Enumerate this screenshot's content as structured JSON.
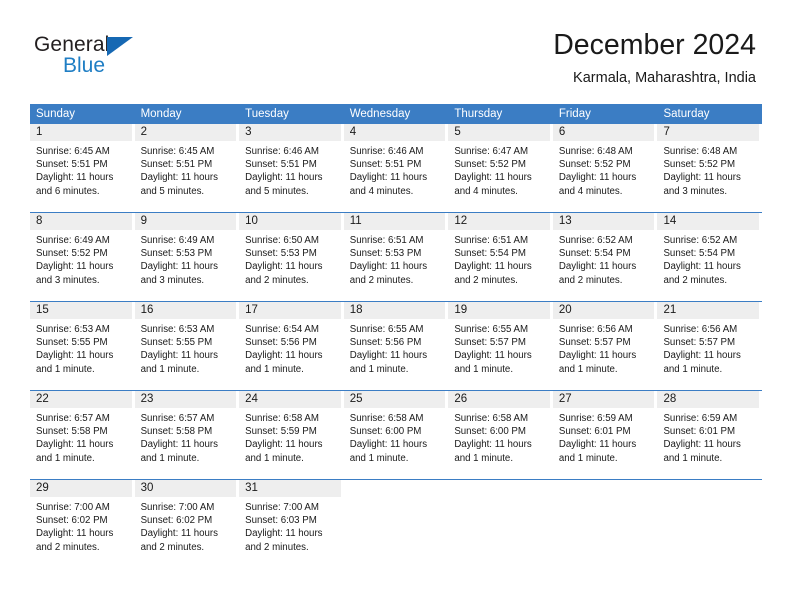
{
  "brand": {
    "name_part1": "General",
    "name_part2": "Blue",
    "accent_color": "#1f7ec4",
    "triangle_color": "#1668b3"
  },
  "header": {
    "title": "December 2024",
    "location": "Karmala, Maharashtra, India"
  },
  "calendar": {
    "header_color": "#3b7dc4",
    "daynum_band_color": "#eeeeee",
    "weekday_names": [
      "Sunday",
      "Monday",
      "Tuesday",
      "Wednesday",
      "Thursday",
      "Friday",
      "Saturday"
    ],
    "weeks": [
      [
        {
          "day": "1",
          "sunrise": "Sunrise: 6:45 AM",
          "sunset": "Sunset: 5:51 PM",
          "daylight_line1": "Daylight: 11 hours",
          "daylight_line2": "and 6 minutes."
        },
        {
          "day": "2",
          "sunrise": "Sunrise: 6:45 AM",
          "sunset": "Sunset: 5:51 PM",
          "daylight_line1": "Daylight: 11 hours",
          "daylight_line2": "and 5 minutes."
        },
        {
          "day": "3",
          "sunrise": "Sunrise: 6:46 AM",
          "sunset": "Sunset: 5:51 PM",
          "daylight_line1": "Daylight: 11 hours",
          "daylight_line2": "and 5 minutes."
        },
        {
          "day": "4",
          "sunrise": "Sunrise: 6:46 AM",
          "sunset": "Sunset: 5:51 PM",
          "daylight_line1": "Daylight: 11 hours",
          "daylight_line2": "and 4 minutes."
        },
        {
          "day": "5",
          "sunrise": "Sunrise: 6:47 AM",
          "sunset": "Sunset: 5:52 PM",
          "daylight_line1": "Daylight: 11 hours",
          "daylight_line2": "and 4 minutes."
        },
        {
          "day": "6",
          "sunrise": "Sunrise: 6:48 AM",
          "sunset": "Sunset: 5:52 PM",
          "daylight_line1": "Daylight: 11 hours",
          "daylight_line2": "and 4 minutes."
        },
        {
          "day": "7",
          "sunrise": "Sunrise: 6:48 AM",
          "sunset": "Sunset: 5:52 PM",
          "daylight_line1": "Daylight: 11 hours",
          "daylight_line2": "and 3 minutes."
        }
      ],
      [
        {
          "day": "8",
          "sunrise": "Sunrise: 6:49 AM",
          "sunset": "Sunset: 5:52 PM",
          "daylight_line1": "Daylight: 11 hours",
          "daylight_line2": "and 3 minutes."
        },
        {
          "day": "9",
          "sunrise": "Sunrise: 6:49 AM",
          "sunset": "Sunset: 5:53 PM",
          "daylight_line1": "Daylight: 11 hours",
          "daylight_line2": "and 3 minutes."
        },
        {
          "day": "10",
          "sunrise": "Sunrise: 6:50 AM",
          "sunset": "Sunset: 5:53 PM",
          "daylight_line1": "Daylight: 11 hours",
          "daylight_line2": "and 2 minutes."
        },
        {
          "day": "11",
          "sunrise": "Sunrise: 6:51 AM",
          "sunset": "Sunset: 5:53 PM",
          "daylight_line1": "Daylight: 11 hours",
          "daylight_line2": "and 2 minutes."
        },
        {
          "day": "12",
          "sunrise": "Sunrise: 6:51 AM",
          "sunset": "Sunset: 5:54 PM",
          "daylight_line1": "Daylight: 11 hours",
          "daylight_line2": "and 2 minutes."
        },
        {
          "day": "13",
          "sunrise": "Sunrise: 6:52 AM",
          "sunset": "Sunset: 5:54 PM",
          "daylight_line1": "Daylight: 11 hours",
          "daylight_line2": "and 2 minutes."
        },
        {
          "day": "14",
          "sunrise": "Sunrise: 6:52 AM",
          "sunset": "Sunset: 5:54 PM",
          "daylight_line1": "Daylight: 11 hours",
          "daylight_line2": "and 2 minutes."
        }
      ],
      [
        {
          "day": "15",
          "sunrise": "Sunrise: 6:53 AM",
          "sunset": "Sunset: 5:55 PM",
          "daylight_line1": "Daylight: 11 hours",
          "daylight_line2": "and 1 minute."
        },
        {
          "day": "16",
          "sunrise": "Sunrise: 6:53 AM",
          "sunset": "Sunset: 5:55 PM",
          "daylight_line1": "Daylight: 11 hours",
          "daylight_line2": "and 1 minute."
        },
        {
          "day": "17",
          "sunrise": "Sunrise: 6:54 AM",
          "sunset": "Sunset: 5:56 PM",
          "daylight_line1": "Daylight: 11 hours",
          "daylight_line2": "and 1 minute."
        },
        {
          "day": "18",
          "sunrise": "Sunrise: 6:55 AM",
          "sunset": "Sunset: 5:56 PM",
          "daylight_line1": "Daylight: 11 hours",
          "daylight_line2": "and 1 minute."
        },
        {
          "day": "19",
          "sunrise": "Sunrise: 6:55 AM",
          "sunset": "Sunset: 5:57 PM",
          "daylight_line1": "Daylight: 11 hours",
          "daylight_line2": "and 1 minute."
        },
        {
          "day": "20",
          "sunrise": "Sunrise: 6:56 AM",
          "sunset": "Sunset: 5:57 PM",
          "daylight_line1": "Daylight: 11 hours",
          "daylight_line2": "and 1 minute."
        },
        {
          "day": "21",
          "sunrise": "Sunrise: 6:56 AM",
          "sunset": "Sunset: 5:57 PM",
          "daylight_line1": "Daylight: 11 hours",
          "daylight_line2": "and 1 minute."
        }
      ],
      [
        {
          "day": "22",
          "sunrise": "Sunrise: 6:57 AM",
          "sunset": "Sunset: 5:58 PM",
          "daylight_line1": "Daylight: 11 hours",
          "daylight_line2": "and 1 minute."
        },
        {
          "day": "23",
          "sunrise": "Sunrise: 6:57 AM",
          "sunset": "Sunset: 5:58 PM",
          "daylight_line1": "Daylight: 11 hours",
          "daylight_line2": "and 1 minute."
        },
        {
          "day": "24",
          "sunrise": "Sunrise: 6:58 AM",
          "sunset": "Sunset: 5:59 PM",
          "daylight_line1": "Daylight: 11 hours",
          "daylight_line2": "and 1 minute."
        },
        {
          "day": "25",
          "sunrise": "Sunrise: 6:58 AM",
          "sunset": "Sunset: 6:00 PM",
          "daylight_line1": "Daylight: 11 hours",
          "daylight_line2": "and 1 minute."
        },
        {
          "day": "26",
          "sunrise": "Sunrise: 6:58 AM",
          "sunset": "Sunset: 6:00 PM",
          "daylight_line1": "Daylight: 11 hours",
          "daylight_line2": "and 1 minute."
        },
        {
          "day": "27",
          "sunrise": "Sunrise: 6:59 AM",
          "sunset": "Sunset: 6:01 PM",
          "daylight_line1": "Daylight: 11 hours",
          "daylight_line2": "and 1 minute."
        },
        {
          "day": "28",
          "sunrise": "Sunrise: 6:59 AM",
          "sunset": "Sunset: 6:01 PM",
          "daylight_line1": "Daylight: 11 hours",
          "daylight_line2": "and 1 minute."
        }
      ],
      [
        {
          "day": "29",
          "sunrise": "Sunrise: 7:00 AM",
          "sunset": "Sunset: 6:02 PM",
          "daylight_line1": "Daylight: 11 hours",
          "daylight_line2": "and 2 minutes."
        },
        {
          "day": "30",
          "sunrise": "Sunrise: 7:00 AM",
          "sunset": "Sunset: 6:02 PM",
          "daylight_line1": "Daylight: 11 hours",
          "daylight_line2": "and 2 minutes."
        },
        {
          "day": "31",
          "sunrise": "Sunrise: 7:00 AM",
          "sunset": "Sunset: 6:03 PM",
          "daylight_line1": "Daylight: 11 hours",
          "daylight_line2": "and 2 minutes."
        },
        {
          "day": "",
          "sunrise": "",
          "sunset": "",
          "daylight_line1": "",
          "daylight_line2": ""
        },
        {
          "day": "",
          "sunrise": "",
          "sunset": "",
          "daylight_line1": "",
          "daylight_line2": ""
        },
        {
          "day": "",
          "sunrise": "",
          "sunset": "",
          "daylight_line1": "",
          "daylight_line2": ""
        },
        {
          "day": "",
          "sunrise": "",
          "sunset": "",
          "daylight_line1": "",
          "daylight_line2": ""
        }
      ]
    ]
  }
}
